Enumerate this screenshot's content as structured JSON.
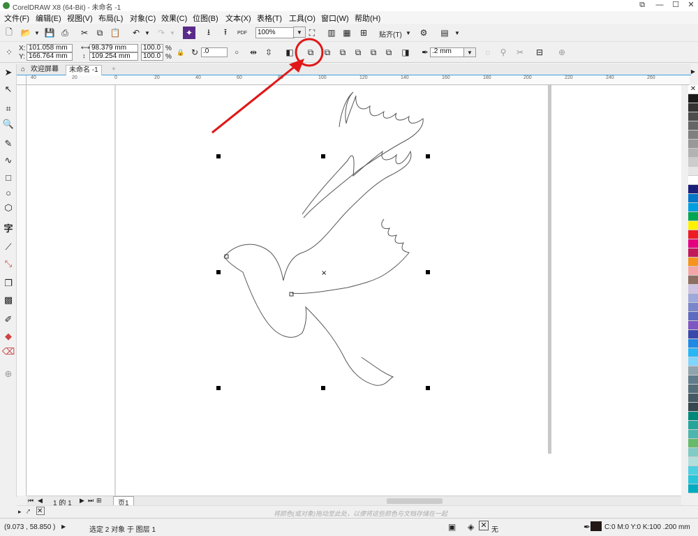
{
  "window": {
    "title": "CorelDRAW X8 (64-Bit) - 未命名 -1"
  },
  "menu": [
    {
      "label": "文件(F)"
    },
    {
      "label": "编辑(E)"
    },
    {
      "label": "视图(V)"
    },
    {
      "label": "布局(L)"
    },
    {
      "label": "对象(C)"
    },
    {
      "label": "效果(C)"
    },
    {
      "label": "位图(B)"
    },
    {
      "label": "文本(X)"
    },
    {
      "label": "表格(T)"
    },
    {
      "label": "工具(O)"
    },
    {
      "label": "窗口(W)"
    },
    {
      "label": "帮助(H)"
    }
  ],
  "toolbar": {
    "pdf_label": "PDF",
    "zoom_value": "100%",
    "snap_label": "贴齐(T)"
  },
  "propbar": {
    "x_label": "X:",
    "x_value": "101.058 mm",
    "y_label": "Y:",
    "y_value": "166.764 mm",
    "w_value": "98.379 mm",
    "h_value": "109.254 mm",
    "scale_w": "100.0",
    "scale_h": "100.0",
    "pct": "%",
    "rotation_value": ".0",
    "outline_value": ".2 mm"
  },
  "tabs": {
    "welcome": "欢迎屏幕",
    "doc": "未命名 -1"
  },
  "ruler": {
    "h_ticks": [
      "40",
      "20",
      "0",
      "20",
      "40",
      "60",
      "80",
      "100",
      "120",
      "140",
      "160",
      "180",
      "200",
      "220",
      "240",
      "260"
    ]
  },
  "pagebar": {
    "page_info": "1 的 1",
    "page_tab": "页1"
  },
  "hint": "将颜色(或对象)拖动至此处，以便将这些颜色与文档存储在一起",
  "status": {
    "coords": "(9.073 , 58.850 )",
    "selection": "选定 2 对象 于 图层 1",
    "fill_label": "无",
    "outline_info": "C:0 M:0 Y:0 K:100  .200 mm"
  },
  "palette_colors": [
    "#ffffff",
    "#1a1a1a",
    "#333333",
    "#4d4d4d",
    "#666666",
    "#808080",
    "#999999",
    "#b3b3b3",
    "#cccccc",
    "#e6e6e6",
    "#ffffff",
    "#1b1f7a",
    "#0077c8",
    "#00a0e0",
    "#00a651",
    "#fff200",
    "#ed1c24",
    "#e4007f",
    "#c2185b",
    "#f7941d",
    "#f4a6a6",
    "#8d6e63",
    "#cfc3e3",
    "#9fa8da",
    "#7986cb",
    "#5c6bc0",
    "#7e57c2",
    "#3949ab",
    "#1e88e5",
    "#29b6f6",
    "#81d4fa",
    "#90a4ae",
    "#607d8b",
    "#546e7a",
    "#455a64",
    "#37474f",
    "#00897b",
    "#26a69a",
    "#4db6ac",
    "#66bb6a",
    "#80cbc4",
    "#b2dfdb",
    "#4dd0e1",
    "#26c6da",
    "#00acc1"
  ],
  "colors": {
    "accent": "#3aa0e0",
    "annotation": "#e01818"
  }
}
